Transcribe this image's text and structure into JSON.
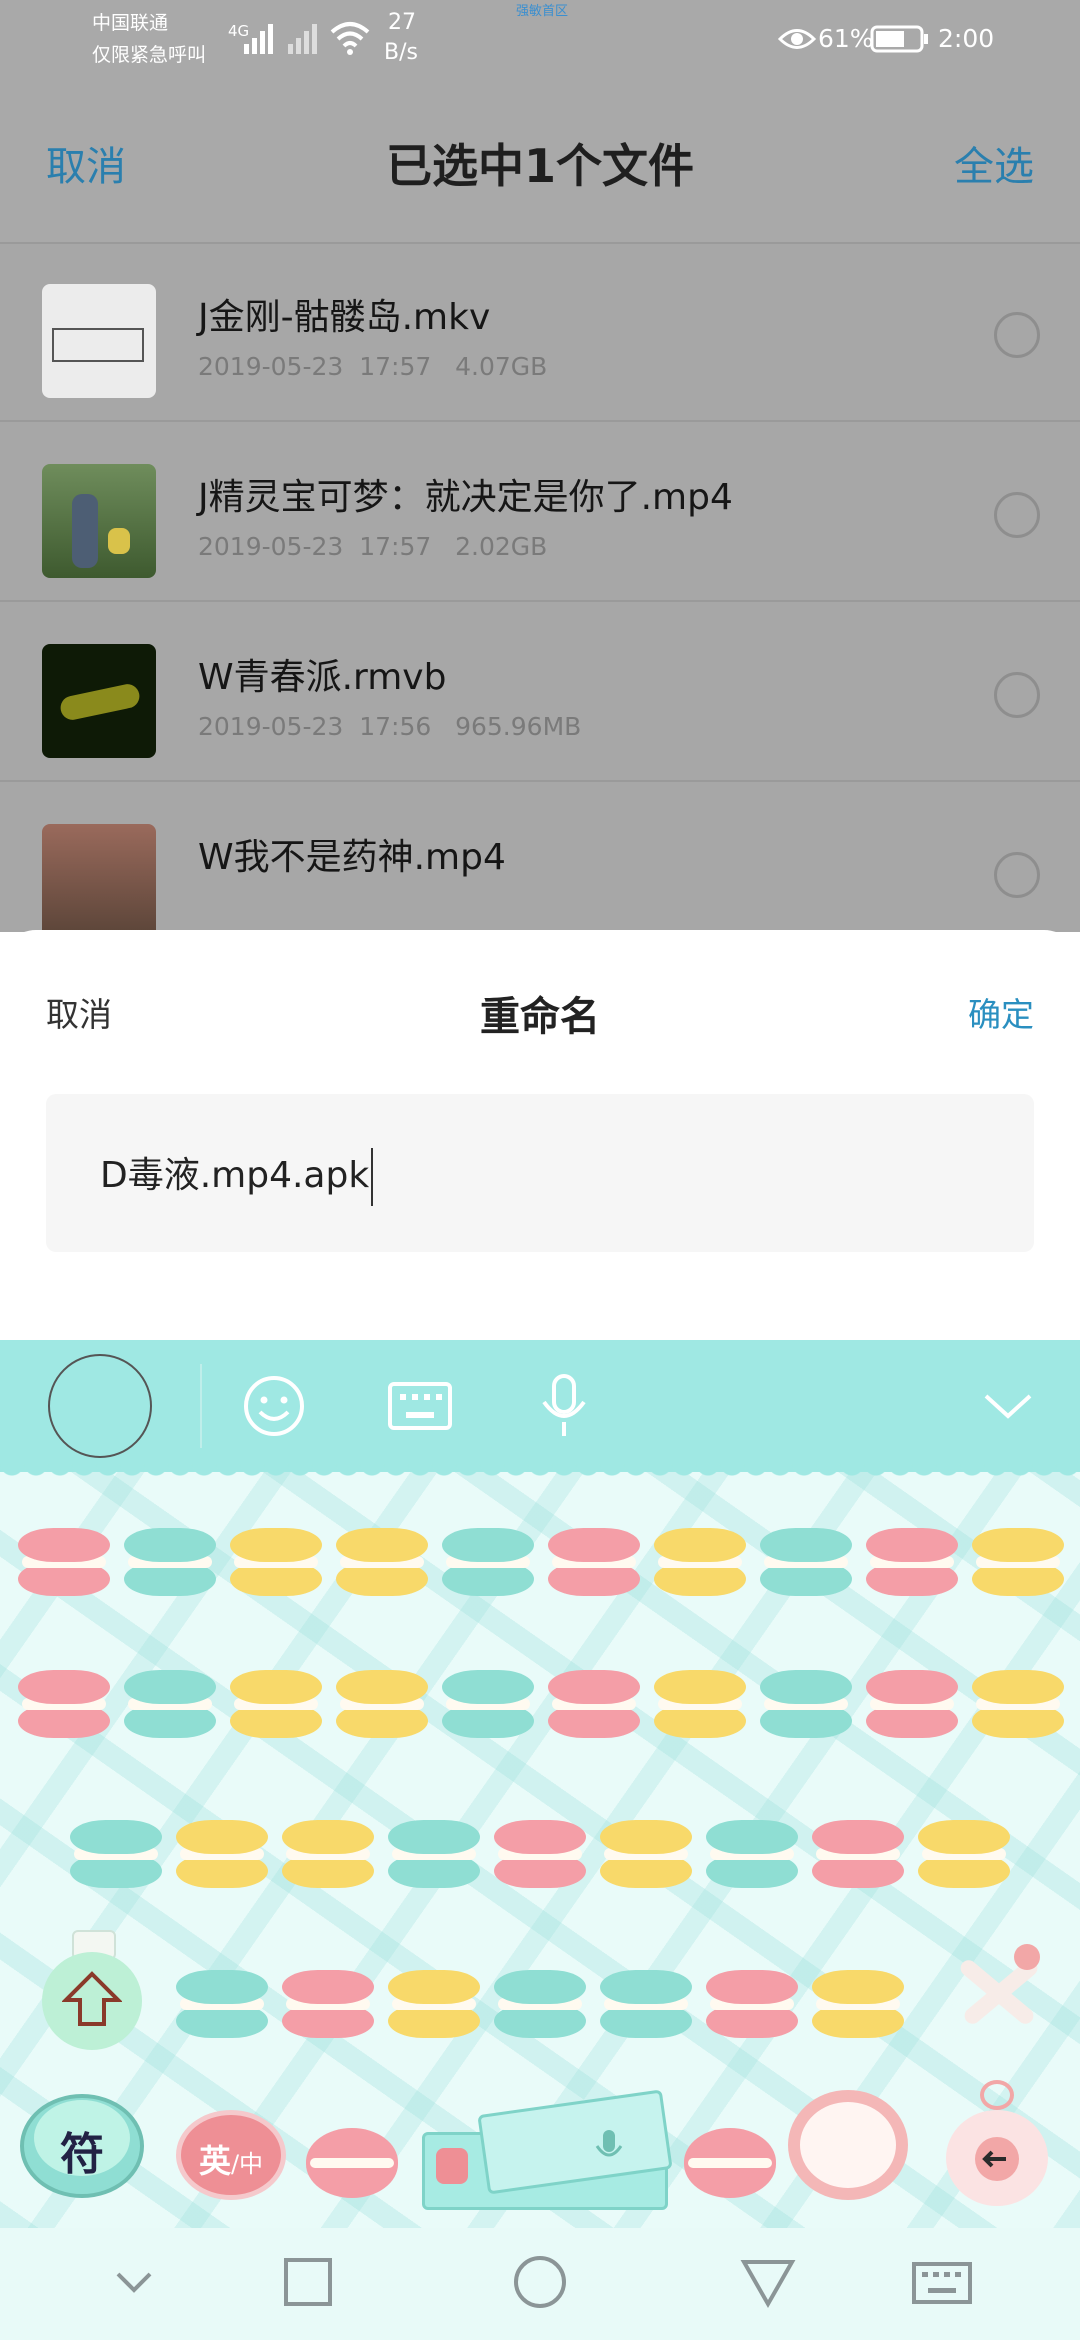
{
  "status": {
    "carrier": "中国联通",
    "carrier_note": "仅限紧急呼叫",
    "network_type": "4G",
    "speed_value": "27",
    "speed_unit": "B/s",
    "battery_percent": "61%",
    "time": "2:00",
    "top_caption": "强敏首区"
  },
  "header": {
    "cancel": "取消",
    "title": "已选中1个文件",
    "select_all": "全选"
  },
  "files": [
    {
      "name": "J金刚-骷髅岛.mkv",
      "date": "2019-05-23",
      "time": "17:57",
      "size": "4.07GB",
      "thumb_color": "#ececec"
    },
    {
      "name": "J精灵宝可梦：就决定是你了.mp4",
      "date": "2019-05-23",
      "time": "17:57",
      "size": "2.02GB",
      "thumb_color": "#4b6a3a"
    },
    {
      "name": "W青春派.rmvb",
      "date": "2019-05-23",
      "time": "17:56",
      "size": "965.96MB",
      "thumb_color": "#1c2a10"
    },
    {
      "name": "W我不是药神.mp4",
      "date": "",
      "time": "",
      "size": "",
      "thumb_color": "#6b5346"
    }
  ],
  "rename_dialog": {
    "cancel": "取消",
    "title": "重命名",
    "confirm": "确定",
    "value": "D毒液.mp4.apk"
  },
  "keyboard": {
    "symbol_key": "符",
    "lang_key_primary": "英",
    "lang_key_secondary": "/中",
    "toolbar_icons": [
      "emoji-icon",
      "keyboard-icon",
      "microphone-icon",
      "chevron-down-icon"
    ],
    "colors": {
      "toolbar": "#9fe8e3",
      "pink": "#f49ea7",
      "teal": "#8fded3",
      "yellow": "#f8d96a"
    }
  },
  "navigation": {
    "icons": [
      "chevron-down-icon",
      "recent-apps-icon",
      "home-icon",
      "back-icon",
      "keyboard-icon"
    ]
  }
}
